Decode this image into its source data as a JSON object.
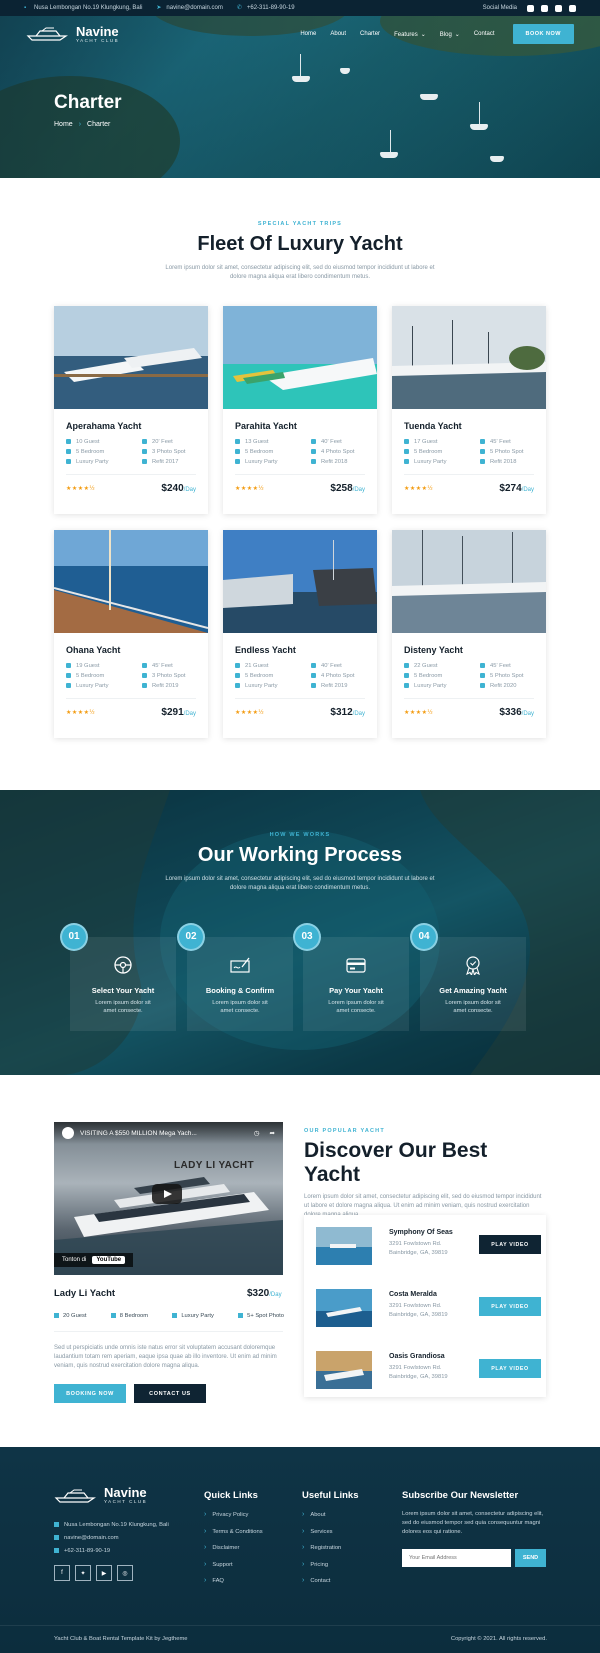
{
  "topbar": {
    "address": "Nusa Lembongan No.19 Klungkung, Bali",
    "email": "navine@domain.com",
    "phone": "+62-311-89-90-19",
    "social_label": "Social Media",
    "social_icons": [
      "facebook-icon",
      "twitter-icon",
      "youtube-icon",
      "instagram-icon"
    ]
  },
  "nav": {
    "logo_name": "Navine",
    "logo_sub": "YACHT CLUB",
    "items": [
      "Home",
      "About",
      "Charter",
      "Features",
      "Blog",
      "Contact"
    ],
    "book_button": "BOOK NOW"
  },
  "hero": {
    "title": "Charter",
    "breadcrumb_home": "Home",
    "breadcrumb_current": "Charter"
  },
  "fleet": {
    "eyebrow": "SPECIAL YACHT TRIPS",
    "title": "Fleet Of Luxury Yacht",
    "lead": "Lorem ipsum dolor sit amet, consectetur adipiscing elit, sed do eiusmod tempor incididunt ut labore et dolore magna aliqua erat libero condimentum metus.",
    "per_label": "/Day",
    "stars": "★★★★½",
    "yachts": [
      {
        "name": "Aperahama Yacht",
        "guest": "10 Guest",
        "length": "20' Feet",
        "bedroom": "5 Bedroom",
        "spot": "3 Photo Spot",
        "party": "Luxury Party",
        "refit": "Refit 2017",
        "price": "$240"
      },
      {
        "name": "Parahita Yacht",
        "guest": "13 Guest",
        "length": "40' Feet",
        "bedroom": "5 Bedroom",
        "spot": "4 Photo Spot",
        "party": "Luxury Party",
        "refit": "Refit 2018",
        "price": "$258"
      },
      {
        "name": "Tuenda Yacht",
        "guest": "17 Guest",
        "length": "45' Feet",
        "bedroom": "5 Bedroom",
        "spot": "5 Photo Spot",
        "party": "Luxury Party",
        "refit": "Refit 2018",
        "price": "$274"
      },
      {
        "name": "Ohana Yacht",
        "guest": "19 Guest",
        "length": "45' Feet",
        "bedroom": "5 Bedroom",
        "spot": "3 Photo Spot",
        "party": "Luxury Party",
        "refit": "Refit 2019",
        "price": "$291"
      },
      {
        "name": "Endless Yacht",
        "guest": "21 Guest",
        "length": "40' Feet",
        "bedroom": "5 Bedroom",
        "spot": "4 Photo Spot",
        "party": "Luxury Party",
        "refit": "Refit 2019",
        "price": "$312"
      },
      {
        "name": "Disteny Yacht",
        "guest": "22 Guest",
        "length": "45' Feet",
        "bedroom": "5 Bedroom",
        "spot": "5 Photo Spot",
        "party": "Luxury Party",
        "refit": "Refit 2020",
        "price": "$336"
      }
    ]
  },
  "process": {
    "eyebrow": "HOW WE WORKS",
    "title": "Our Working Process",
    "lead": "Lorem ipsum dolor sit amet, consectetur adipiscing elit, sed do eiusmod tempor incididunt ut labore et dolore magna aliqua erat libero condimentum metus.",
    "steps": [
      {
        "num": "01",
        "title": "Select Your Yacht",
        "desc1": "Lorem ipsum dolor sit",
        "desc2": "amet consecte.",
        "icon": "steering-wheel-icon"
      },
      {
        "num": "02",
        "title": "Booking & Confirm",
        "desc1": "Lorem ipsum dolor sit",
        "desc2": "amet consecte.",
        "icon": "cheque-sign-icon"
      },
      {
        "num": "03",
        "title": "Pay Your Yacht",
        "desc1": "Lorem ipsum dolor sit",
        "desc2": "amet consecte.",
        "icon": "credit-card-icon"
      },
      {
        "num": "04",
        "title": "Get Amazing Yacht",
        "desc1": "Lorem ipsum dolor sit",
        "desc2": "amet consecte.",
        "icon": "award-badge-icon"
      }
    ]
  },
  "video": {
    "title": "VISITING A $550 MILLION Mega Yach...",
    "label": "LADY LI YACHT",
    "watch_on": "Tonton di",
    "youtube": "YouTube"
  },
  "lady": {
    "title": "Lady Li Yacht",
    "price": "$320",
    "per": "/Day",
    "specs": [
      "20 Guest",
      "8 Bedroom",
      "Luxury Party",
      "5+ Spot Photo"
    ],
    "desc": "Sed ut perspiciatis unde omnis iste natus error sit voluptatem accusant doloremque laudantium totam rem aperiam, eaque ipsa quae ab illo inventore. Ut enim ad minim veniam, quis nostrud exercitation dolore magna aliqua.",
    "booking_button": "BOOKING NOW",
    "contact_button": "CONTACT US"
  },
  "discover": {
    "eyebrow": "OUR POPULAR YACHT",
    "title": "Discover Our Best Yacht",
    "lead": "Lorem ipsum dolor sit amet, consectetur adipiscing elit, sed do eiusmod tempor incididunt ut labore et dolore magna aliqua. Ut enim ad minim veniam, quis nostrud exercitation dolore magna aliqua.",
    "play_label": "PLAY VIDEO",
    "items": [
      {
        "title": "Symphony Of Seas",
        "addr1": "3291 Fowlstown Rd.",
        "addr2": "Bainbridge, GA, 39819"
      },
      {
        "title": "Costa Meralda",
        "addr1": "3291 Fowlstown Rd.",
        "addr2": "Bainbridge, GA, 39819"
      },
      {
        "title": "Oasis Grandiosa",
        "addr1": "3291 Fowlstown Rd.",
        "addr2": "Bainbridge, GA, 39819"
      }
    ]
  },
  "footer": {
    "logo_name": "Navine",
    "logo_sub": "YACHT CLUB",
    "address": "Nusa Lembongan No.19 Klungkung, Bali",
    "email": "navine@domain.com",
    "phone": "+62-311-89-90-19",
    "quick_title": "Quick Links",
    "quick_links": [
      "Privacy Policy",
      "Terms & Conditions",
      "Disclaimer",
      "Support",
      "FAQ"
    ],
    "useful_title": "Useful Links",
    "useful_links": [
      "About",
      "Services",
      "Registration",
      "Pricing",
      "Contact"
    ],
    "news_title": "Subscribe Our Newsletter",
    "news_text": "Lorem ipsum dolor sit amet, consectetur adipiscing elit, sed do eiusmod tempor sed quia consequuntur magni dolores eos qui ratione.",
    "email_placeholder": "Your Email Address",
    "send_label": "SEND",
    "credit": "Yacht Club & Boat Rental Template Kit by Jegtheme",
    "copyright": "Copyright © 2021. All rights reserved."
  },
  "colors": {
    "accent": "#3fb3d2",
    "navy": "#0b2333",
    "dark_button": "#0f2433"
  }
}
